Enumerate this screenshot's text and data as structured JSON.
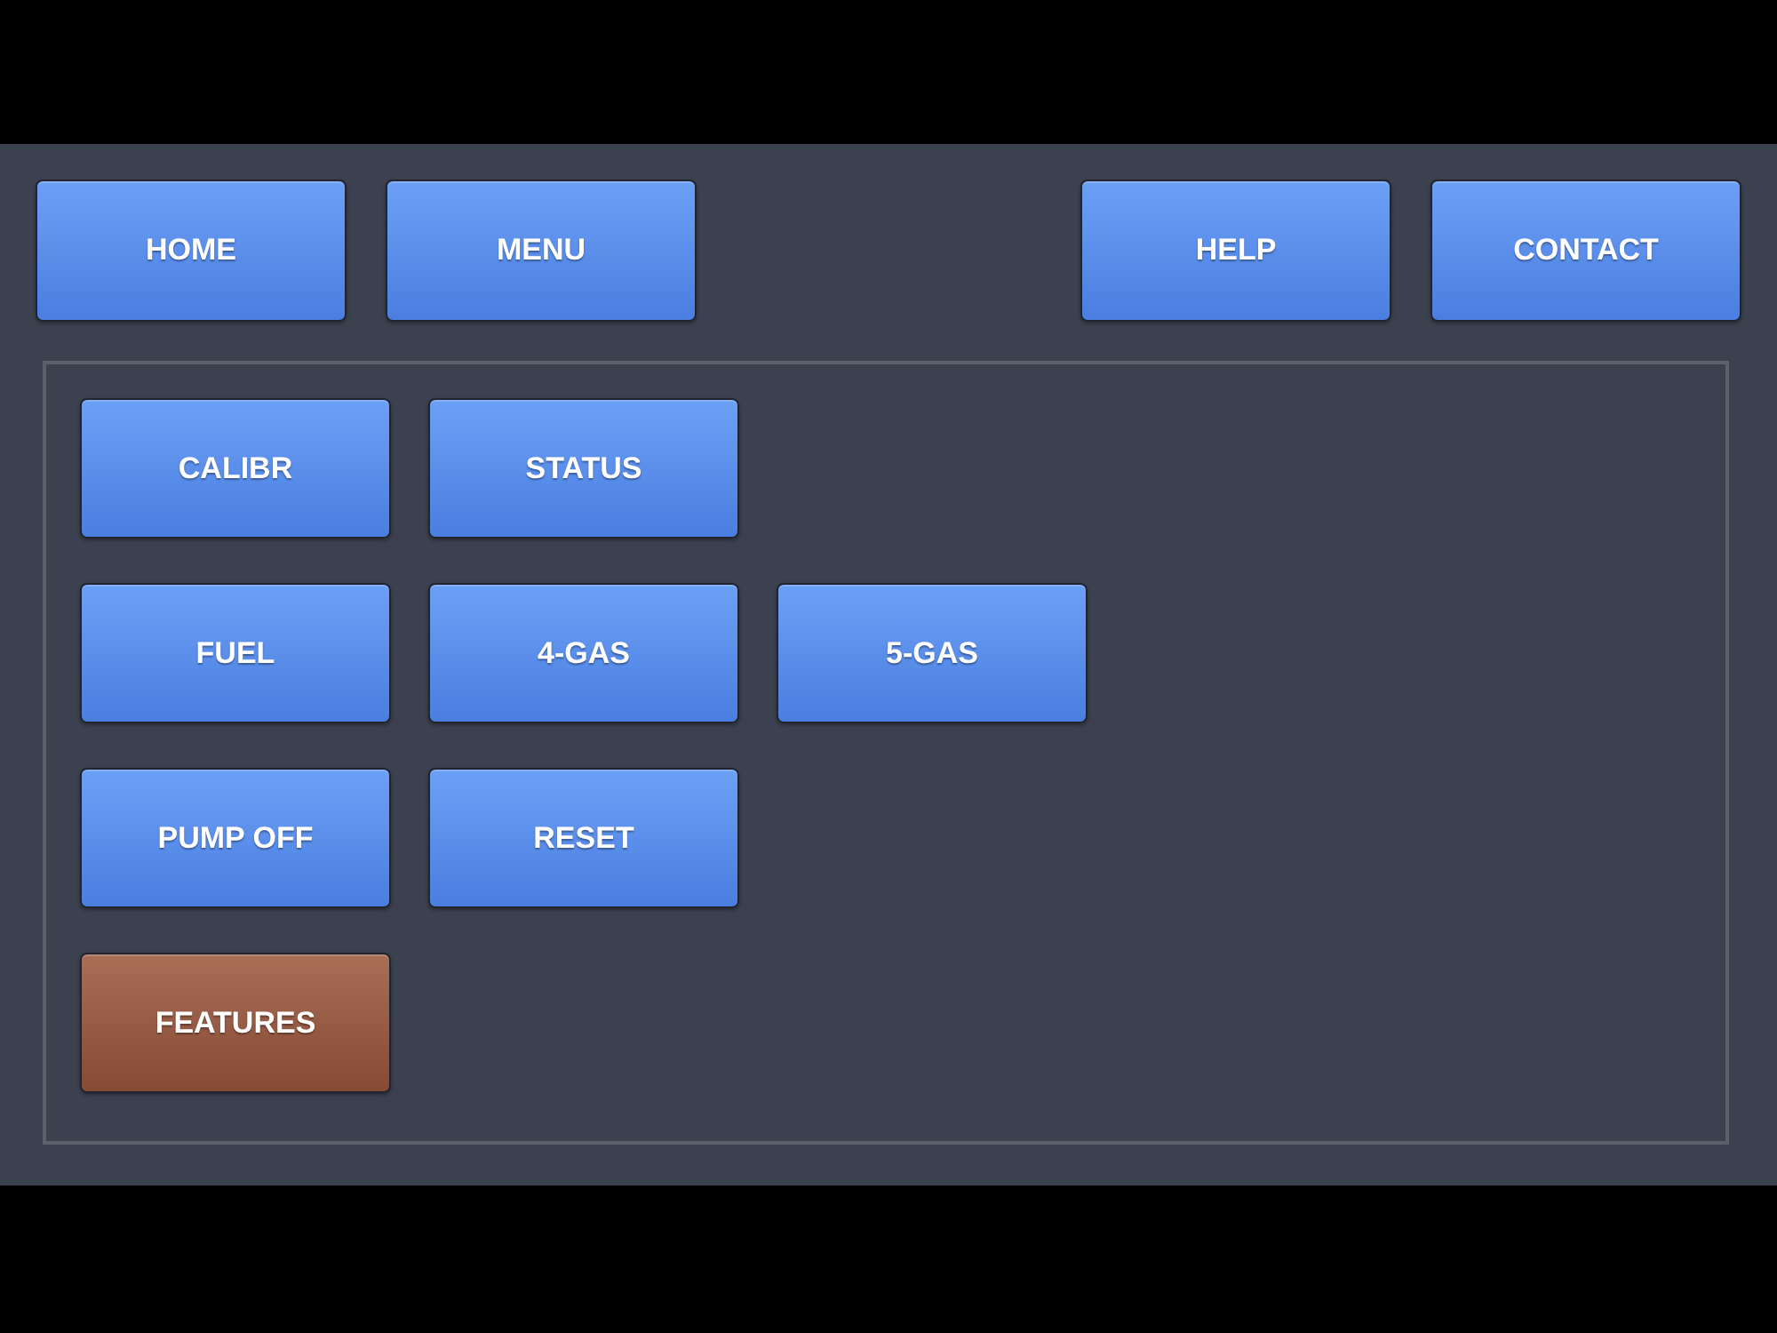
{
  "nav": {
    "left": [
      {
        "label": "HOME"
      },
      {
        "label": "MENU"
      }
    ],
    "right": [
      {
        "label": "HELP"
      },
      {
        "label": "CONTACT"
      }
    ]
  },
  "panel": {
    "rows": [
      [
        {
          "label": "CALIBR",
          "selected": false
        },
        {
          "label": "STATUS",
          "selected": false
        }
      ],
      [
        {
          "label": "FUEL",
          "selected": false
        },
        {
          "label": "4-GAS",
          "selected": false
        },
        {
          "label": "5-GAS",
          "selected": false
        }
      ],
      [
        {
          "label": "PUMP OFF",
          "selected": false
        },
        {
          "label": "RESET",
          "selected": false
        }
      ],
      [
        {
          "label": "FEATURES",
          "selected": true
        }
      ]
    ]
  }
}
